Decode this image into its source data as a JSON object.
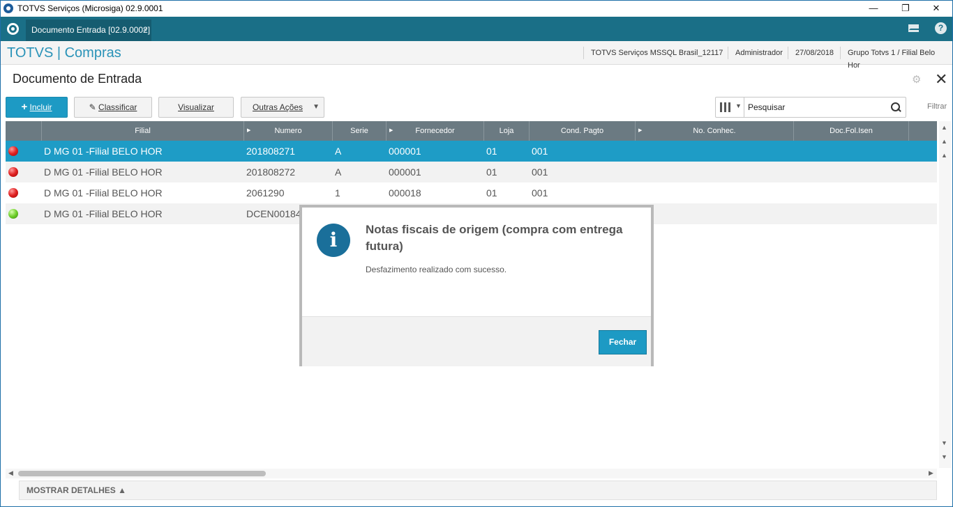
{
  "window": {
    "title": "TOTVS Serviços (Microsiga) 02.9.0001",
    "minimize": "—",
    "restore": "❐",
    "close": "✕"
  },
  "tabbar": {
    "active_tab": "Documento Entrada [02.9.0002]",
    "tab_close": "×",
    "help": "?"
  },
  "header": {
    "brand": "TOTVS | Compras",
    "server": "TOTVS Serviços MSSQL Brasil_12117",
    "user": "Administrador",
    "date": "27/08/2018",
    "branch": "Grupo Totvs 1 / Filial Belo Hor"
  },
  "page": {
    "title": "Documento de Entrada",
    "close": "✕"
  },
  "toolbar": {
    "incluir": "Incluir",
    "incluir_plus": "+",
    "classificar": "Classificar",
    "visualizar": "Visualizar",
    "outras_acoes": "Outras Ações",
    "search_placeholder": "Pesquisar",
    "filtrar": "Filtrar"
  },
  "grid": {
    "columns": [
      {
        "label": "",
        "sortable": false
      },
      {
        "label": "Filial",
        "sortable": false
      },
      {
        "label": "Numero",
        "sortable": true
      },
      {
        "label": "Serie",
        "sortable": false
      },
      {
        "label": "Fornecedor",
        "sortable": true
      },
      {
        "label": "Loja",
        "sortable": false
      },
      {
        "label": "Cond. Pagto",
        "sortable": false
      },
      {
        "label": "No. Conhec.",
        "sortable": true
      },
      {
        "label": "Doc.Fol.Isen",
        "sortable": false
      }
    ],
    "rows": [
      {
        "status": "red",
        "filial": "D MG 01 -Filial BELO HOR",
        "numero": "201808271",
        "serie": "A",
        "fornecedor": "000001",
        "loja": "01",
        "cond": "001",
        "selected": true
      },
      {
        "status": "red",
        "filial": "D MG 01 -Filial BELO HOR",
        "numero": "201808272",
        "serie": "A",
        "fornecedor": "000001",
        "loja": "01",
        "cond": "001",
        "selected": false
      },
      {
        "status": "red",
        "filial": "D MG 01 -Filial BELO HOR",
        "numero": "2061290",
        "serie": "1",
        "fornecedor": "000018",
        "loja": "01",
        "cond": "001",
        "selected": false
      },
      {
        "status": "green",
        "filial": "D MG 01 -Filial BELO HOR",
        "numero": "DCEN00184",
        "serie": "",
        "fornecedor": "",
        "loja": "",
        "cond": "",
        "selected": false
      }
    ]
  },
  "details": {
    "label": "MOSTRAR DETALHES ▲"
  },
  "modal": {
    "icon": "i",
    "title": "Notas fiscais de origem (compra com entrega futura)",
    "message": "Desfazimento realizado com sucesso.",
    "button": "Fechar"
  },
  "colors": {
    "accent": "#1e9cc6",
    "tabbar": "#1a6f87",
    "grid_header": "#6b7a82"
  }
}
